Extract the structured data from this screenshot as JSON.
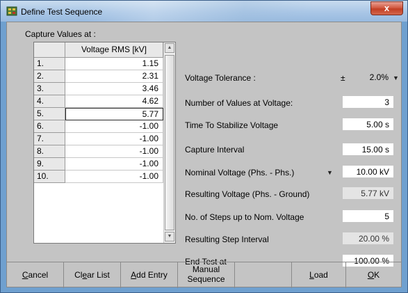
{
  "window": {
    "title": "Define Test Sequence",
    "close_label": "x"
  },
  "capture": {
    "group_label": "Capture Values at :",
    "column_header": "Voltage RMS [kV]",
    "rows": [
      {
        "num": "1.",
        "value": "1.15"
      },
      {
        "num": "2.",
        "value": "2.31"
      },
      {
        "num": "3.",
        "value": "3.46"
      },
      {
        "num": "4.",
        "value": "4.62"
      },
      {
        "num": "5.",
        "value": "5.77"
      },
      {
        "num": "6.",
        "value": "-1.00"
      },
      {
        "num": "7.",
        "value": "-1.00"
      },
      {
        "num": "8.",
        "value": "-1.00"
      },
      {
        "num": "9.",
        "value": "-1.00"
      },
      {
        "num": "10.",
        "value": "-1.00"
      }
    ],
    "selected_row": 5
  },
  "settings": {
    "voltage_tolerance": {
      "label": "Voltage Tolerance :",
      "sign": "±",
      "value": "2.0%"
    },
    "num_values": {
      "label": "Number of Values at Voltage:",
      "value": "3"
    },
    "time_stabilize": {
      "label": "Time To Stabilize Voltage",
      "value": "5.00  s"
    },
    "capture_interval": {
      "label": "Capture Interval",
      "value": "15.00  s"
    },
    "nominal_voltage": {
      "label": "Nominal Voltage (Phs. - Phs.)",
      "value": "10.00 kV"
    },
    "resulting_voltage": {
      "label": "Resulting Voltage (Phs. - Ground)",
      "value": "5.77 kV"
    },
    "steps": {
      "label": "No. of Steps up to Nom. Voltage",
      "value": "5"
    },
    "step_interval": {
      "label": "Resulting Step Interval",
      "value": "20.00 %"
    },
    "end_test": {
      "label": "End Test at",
      "value": "100.00 %"
    }
  },
  "buttons": {
    "cancel": {
      "pre": "",
      "key": "C",
      "post": "ancel"
    },
    "clear_list": {
      "pre": "Cl",
      "key": "e",
      "post": "ar List"
    },
    "add_entry": {
      "pre": "",
      "key": "A",
      "post": "dd Entry"
    },
    "manual_line1": "Manual",
    "manual_line2": "Sequence",
    "load": {
      "pre": "",
      "key": "L",
      "post": "oad"
    },
    "ok": {
      "pre": "",
      "key": "O",
      "post": "K"
    }
  },
  "colors": {
    "client_bg": "#c4c4c4",
    "titlebar": "#a9c6e6",
    "close": "#c23f24"
  }
}
